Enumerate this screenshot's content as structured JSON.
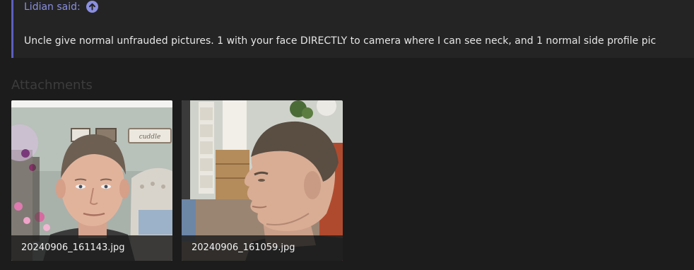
{
  "quote": {
    "author": "Lidian said:",
    "jump_icon": "arrow-up-circle-icon",
    "body": "Uncle give normal unfrauded pictures. 1 with your face DIRECTLY to camera where I can see neck, and 1 normal side profile pic"
  },
  "attachments": {
    "title": "Attachments",
    "items": [
      {
        "filename": "20240906_161143.jpg"
      },
      {
        "filename": "20240906_161059.jpg"
      }
    ]
  },
  "colors": {
    "accent": "#5c5fbf",
    "author": "#8a8fe0",
    "background": "#1c1c1c",
    "quote_background": "#242424"
  }
}
